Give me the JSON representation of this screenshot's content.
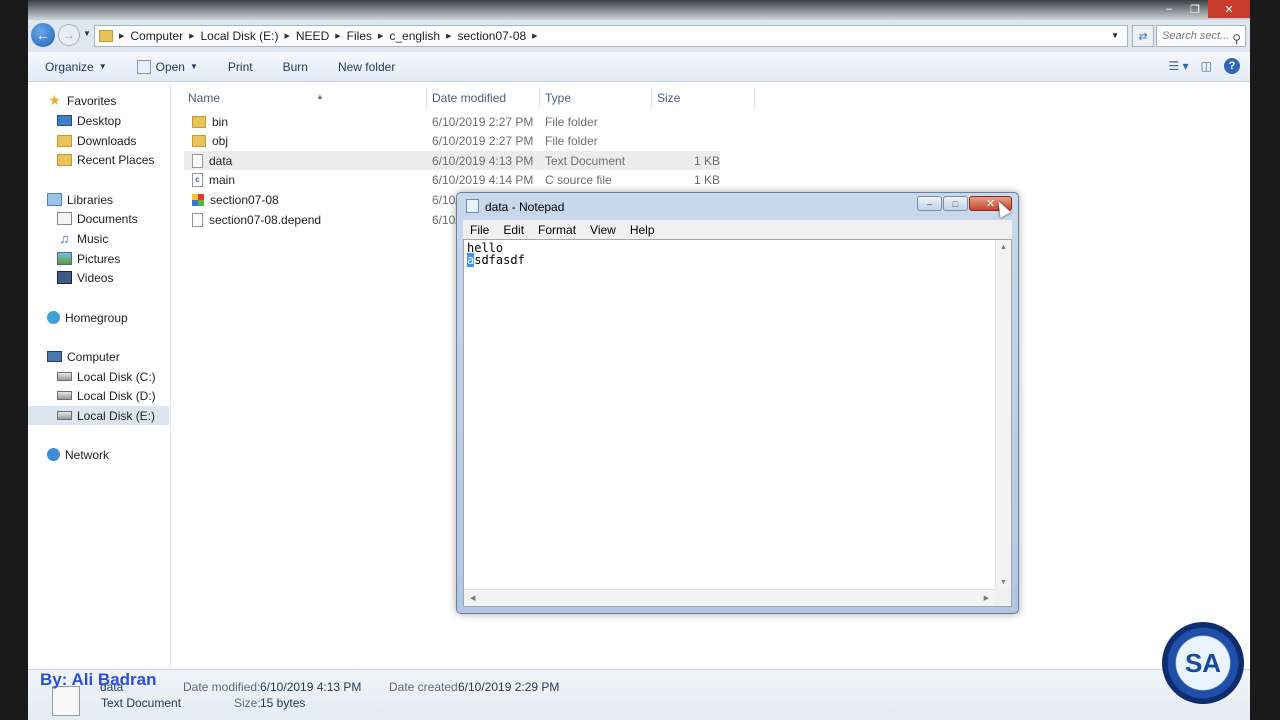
{
  "explorer": {
    "breadcrumb": [
      "Computer",
      "Local Disk (E:)",
      "NEED",
      "Files",
      "c_english",
      "section07-08"
    ],
    "search_placeholder": "Search sect...",
    "toolbar": {
      "organize": "Organize",
      "open": "Open",
      "print": "Print",
      "burn": "Burn",
      "new_folder": "New folder"
    },
    "nav": {
      "favorites": "Favorites",
      "desktop": "Desktop",
      "downloads": "Downloads",
      "recent_places": "Recent Places",
      "libraries": "Libraries",
      "documents": "Documents",
      "music": "Music",
      "pictures": "Pictures",
      "videos": "Videos",
      "homegroup": "Homegroup",
      "computer": "Computer",
      "disk_c": "Local Disk (C:)",
      "disk_d": "Local Disk (D:)",
      "disk_e": "Local Disk (E:)",
      "network": "Network"
    },
    "columns": {
      "name": "Name",
      "date": "Date modified",
      "type": "Type",
      "size": "Size"
    },
    "files": [
      {
        "name": "bin",
        "date": "6/10/2019 2:27 PM",
        "type": "File folder",
        "size": "",
        "icon": "folder-icon"
      },
      {
        "name": "obj",
        "date": "6/10/2019 2:27 PM",
        "type": "File folder",
        "size": "",
        "icon": "folder-icon"
      },
      {
        "name": "data",
        "date": "6/10/2019 4:13 PM",
        "type": "Text Document",
        "size": "1 KB",
        "icon": "text-file-icon"
      },
      {
        "name": "main",
        "date": "6/10/2019 4:14 PM",
        "type": "C source file",
        "size": "1 KB",
        "icon": "c-source-icon"
      },
      {
        "name": "section07-08",
        "date": "6/10/",
        "type": "",
        "size": "",
        "icon": "executable-icon"
      },
      {
        "name": "section07-08.depend",
        "date": "6/10/",
        "type": "",
        "size": "",
        "icon": "text-file-icon"
      }
    ],
    "details": {
      "name": "data",
      "type": "Text Document",
      "date_modified_label": "Date modified:",
      "date_modified": "6/10/2019 4:13 PM",
      "size_label": "Size:",
      "size": "15 bytes",
      "date_created_label": "Date created:",
      "date_created": "6/10/2019 2:29 PM"
    }
  },
  "notepad": {
    "title": "data - Notepad",
    "menu": [
      "File",
      "Edit",
      "Format",
      "View",
      "Help"
    ],
    "line1": "hello",
    "line2_selected": "a",
    "line2_rest": "sdfasdf"
  },
  "watermark": "By: Ali Badran",
  "colors": {
    "accent": "#2b4fd6",
    "selection": "#3399ff"
  }
}
